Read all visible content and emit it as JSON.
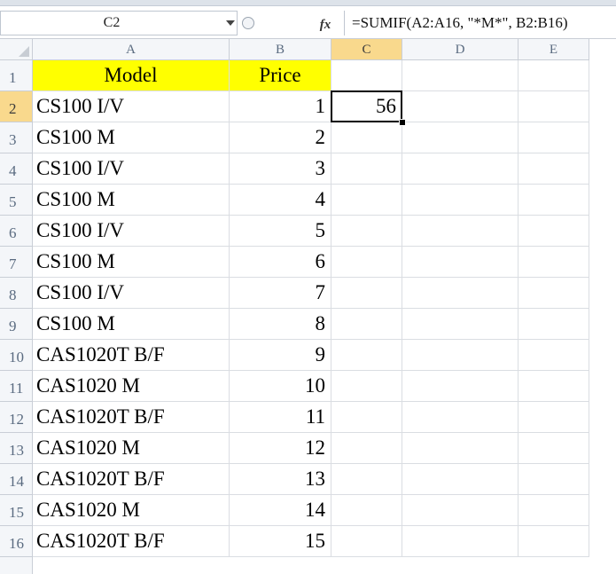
{
  "formula_bar": {
    "name_box": "C2",
    "fx_label": "fx",
    "formula": "=SUMIF(A2:A16, \"*M*\", B2:B16)"
  },
  "columns": [
    "A",
    "B",
    "C",
    "D",
    "E"
  ],
  "rows": [
    "1",
    "2",
    "3",
    "4",
    "5",
    "6",
    "7",
    "8",
    "9",
    "10",
    "11",
    "12",
    "13",
    "14",
    "15",
    "16"
  ],
  "header_row": {
    "model": "Model",
    "price": "Price"
  },
  "data": [
    {
      "model": "CS100 I/V",
      "price": "1"
    },
    {
      "model": "CS100 M",
      "price": "2"
    },
    {
      "model": "CS100 I/V",
      "price": "3"
    },
    {
      "model": "CS100 M",
      "price": "4"
    },
    {
      "model": "CS100 I/V",
      "price": "5"
    },
    {
      "model": "CS100 M",
      "price": "6"
    },
    {
      "model": "CS100 I/V",
      "price": "7"
    },
    {
      "model": "CS100 M",
      "price": "8"
    },
    {
      "model": "CAS1020T B/F",
      "price": "9"
    },
    {
      "model": "CAS1020 M",
      "price": "10"
    },
    {
      "model": "CAS1020T B/F",
      "price": "11"
    },
    {
      "model": "CAS1020 M",
      "price": "12"
    },
    {
      "model": "CAS1020T B/F",
      "price": "13"
    },
    {
      "model": "CAS1020 M",
      "price": "14"
    },
    {
      "model": "CAS1020T B/F",
      "price": "15"
    }
  ],
  "result_cell": {
    "ref": "C2",
    "value": "56"
  },
  "colors": {
    "header_fill": "#ffff00",
    "selected_header": "#f9d98d"
  }
}
